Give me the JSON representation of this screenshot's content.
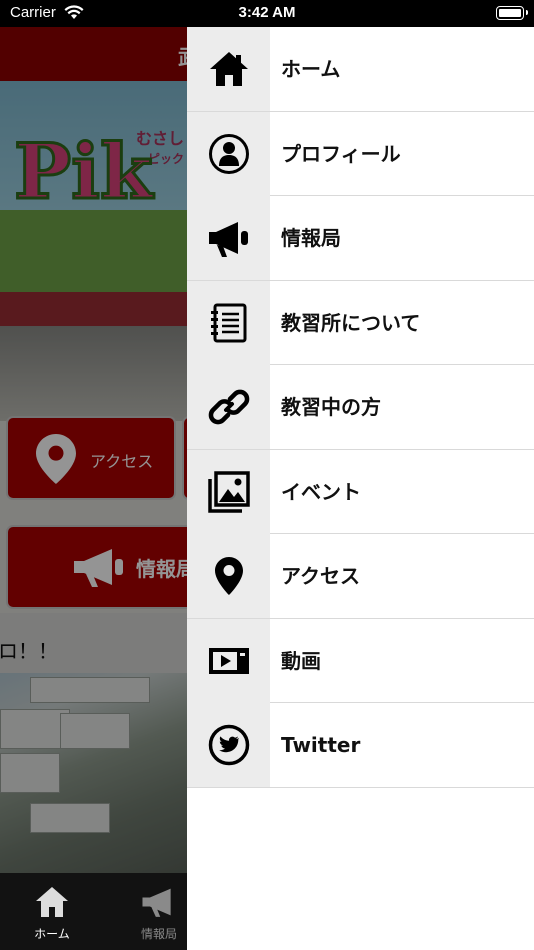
{
  "status_bar": {
    "carrier": "Carrier",
    "time": "3:42 AM"
  },
  "background": {
    "header_text": "武",
    "logo_small_1": "むさし",
    "logo_small_2": "ピック",
    "logo_text": "Pik",
    "tile_access_label": "アクセス",
    "tile_info_label": "情報局",
    "body_text": "ロ！！"
  },
  "tab_bar": {
    "home_label": "ホーム",
    "info_label": "情報局"
  },
  "drawer": {
    "items": [
      {
        "label": "ホーム",
        "icon": "home-icon"
      },
      {
        "label": "プロフィール",
        "icon": "profile-icon"
      },
      {
        "label": "情報局",
        "icon": "megaphone-icon"
      },
      {
        "label": "教習所について",
        "icon": "notebook-icon"
      },
      {
        "label": "教習中の方",
        "icon": "link-icon"
      },
      {
        "label": "イベント",
        "icon": "gallery-icon"
      },
      {
        "label": "アクセス",
        "icon": "location-pin-icon"
      },
      {
        "label": "動画",
        "icon": "video-icon"
      },
      {
        "label": "Twitter",
        "icon": "twitter-icon"
      }
    ]
  },
  "colors": {
    "brand_red": "#aa0000",
    "header_red": "#8d0000",
    "drawer_icon_bg": "#ececec"
  }
}
